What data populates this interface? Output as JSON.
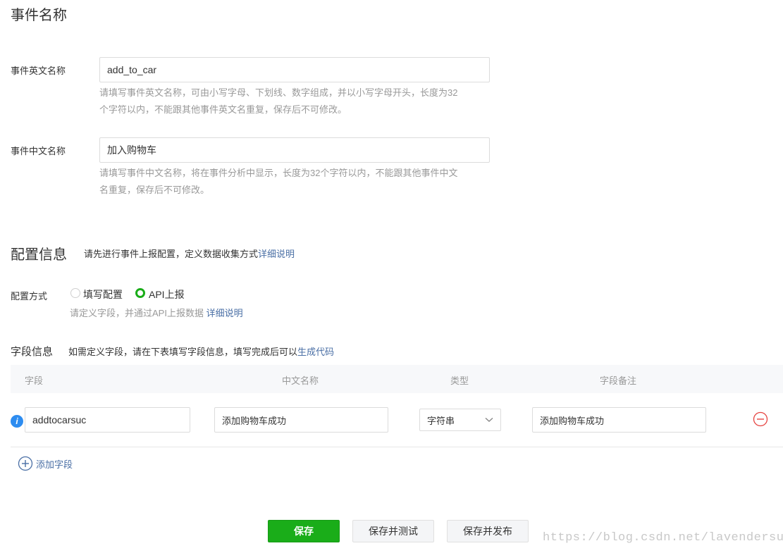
{
  "event_name_section": {
    "title": "事件名称",
    "en_label": "事件英文名称",
    "en_value": "add_to_car",
    "en_hint_line1": "请填写事件英文名称，可由小写字母、下划线、数字组成，并以小写字母开头，长度为32",
    "en_hint_line2": "个字符以内，不能跟其他事件英文名重复，保存后不可修改。",
    "cn_label": "事件中文名称",
    "cn_value": "加入购物车",
    "cn_hint_line1": "请填写事件中文名称，将在事件分析中显示，长度为32个字符以内，不能跟其他事件中文",
    "cn_hint_line2": "名重复，保存后不可修改。"
  },
  "config_section": {
    "title": "配置信息",
    "desc": "请先进行事件上报配置，定义数据收集方式",
    "desc_link": "详细说明",
    "mode_label": "配置方式",
    "option_manual": "填写配置",
    "option_api": "API上报",
    "selected": "API上报",
    "mode_hint": "请定义字段，并通过API上报数据",
    "mode_hint_link": "详细说明"
  },
  "fields_section": {
    "title": "字段信息",
    "desc": "如需定义字段，请在下表填写字段信息，填写完成后可以",
    "desc_link": "生成代码",
    "columns": [
      "字段",
      "中文名称",
      "类型",
      "字段备注"
    ],
    "rows": [
      {
        "field": "addtocarsuc",
        "cn_name": "添加购物车成功",
        "type": "字符串",
        "remark": "添加购物车成功"
      }
    ],
    "add_field": "添加字段"
  },
  "actions": {
    "save": "保存",
    "save_test": "保存并测试",
    "save_publish": "保存并发布"
  },
  "watermark": "https://blog.csdn.net/lavendersue",
  "colors": {
    "primary": "#1aad19",
    "link": "#4a6fa5",
    "info": "#2d8cf0",
    "danger": "#e64340"
  }
}
